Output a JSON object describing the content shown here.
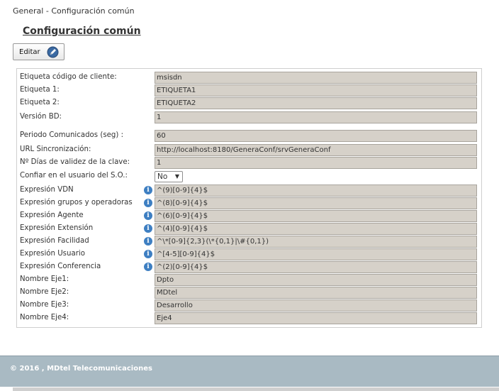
{
  "breadcrumb": "General - Configuración común",
  "page_title": "Configuración común",
  "toolbar": {
    "edit_label": "Editar",
    "edit_icon": "pencil-icon"
  },
  "fields": {
    "cliente": {
      "label": "Etiqueta código de cliente:",
      "value": "msisdn"
    },
    "etiqueta1": {
      "label": "Etiqueta 1:",
      "value": "ETIQUETA1"
    },
    "etiqueta2": {
      "label": "Etiqueta 2:",
      "value": "ETIQUETA2"
    },
    "version_bd": {
      "label": "Versión BD:",
      "value": "1"
    },
    "periodo": {
      "label": "Periodo Comunicados (seg) :",
      "value": "60"
    },
    "url": {
      "label": "URL Sincronización:",
      "value": "http://localhost:8180/GeneraConf/srvGeneraConf"
    },
    "dias_clave": {
      "label": "Nº Días de validez de la clave:",
      "value": "1"
    },
    "confiar": {
      "label": "Confiar en el usuario del S.O.:",
      "value": "No",
      "options": [
        "No"
      ]
    },
    "vdn": {
      "label": "Expresión VDN",
      "value": "^(9)[0-9]{4}$"
    },
    "grupos": {
      "label": "Expresión grupos y operadoras",
      "value": "^(8)[0-9]{4}$"
    },
    "agente": {
      "label": "Expresión Agente",
      "value": "^(6)[0-9]{4}$"
    },
    "extension": {
      "label": "Expresión Extensión",
      "value": "^(4)[0-9]{4}$"
    },
    "facilidad": {
      "label": "Expresión Facilidad",
      "value": "^\\*[0-9]{2,3}(\\*{0,1}|\\#{0,1})"
    },
    "usuario": {
      "label": "Expresión Usuario",
      "value": "^[4-5][0-9]{4}$"
    },
    "conferencia": {
      "label": "Expresión Conferencia",
      "value": "^(2)[0-9]{4}$"
    },
    "eje1": {
      "label": "Nombre Eje1:",
      "value": "Dpto"
    },
    "eje2": {
      "label": "Nombre Eje2:",
      "value": "MDtel"
    },
    "eje3": {
      "label": "Nombre Eje3:",
      "value": "Desarrollo"
    },
    "eje4": {
      "label": "Nombre Eje4:",
      "value": "Eje4"
    }
  },
  "info_icon": "info-icon",
  "footer": {
    "text": "© 2016 , MDtel Telecomunicaciones"
  },
  "colors": {
    "field_bg": "#d6d1c9",
    "footer_bg": "#a9bac3",
    "info_icon": "#3e7fc2"
  }
}
